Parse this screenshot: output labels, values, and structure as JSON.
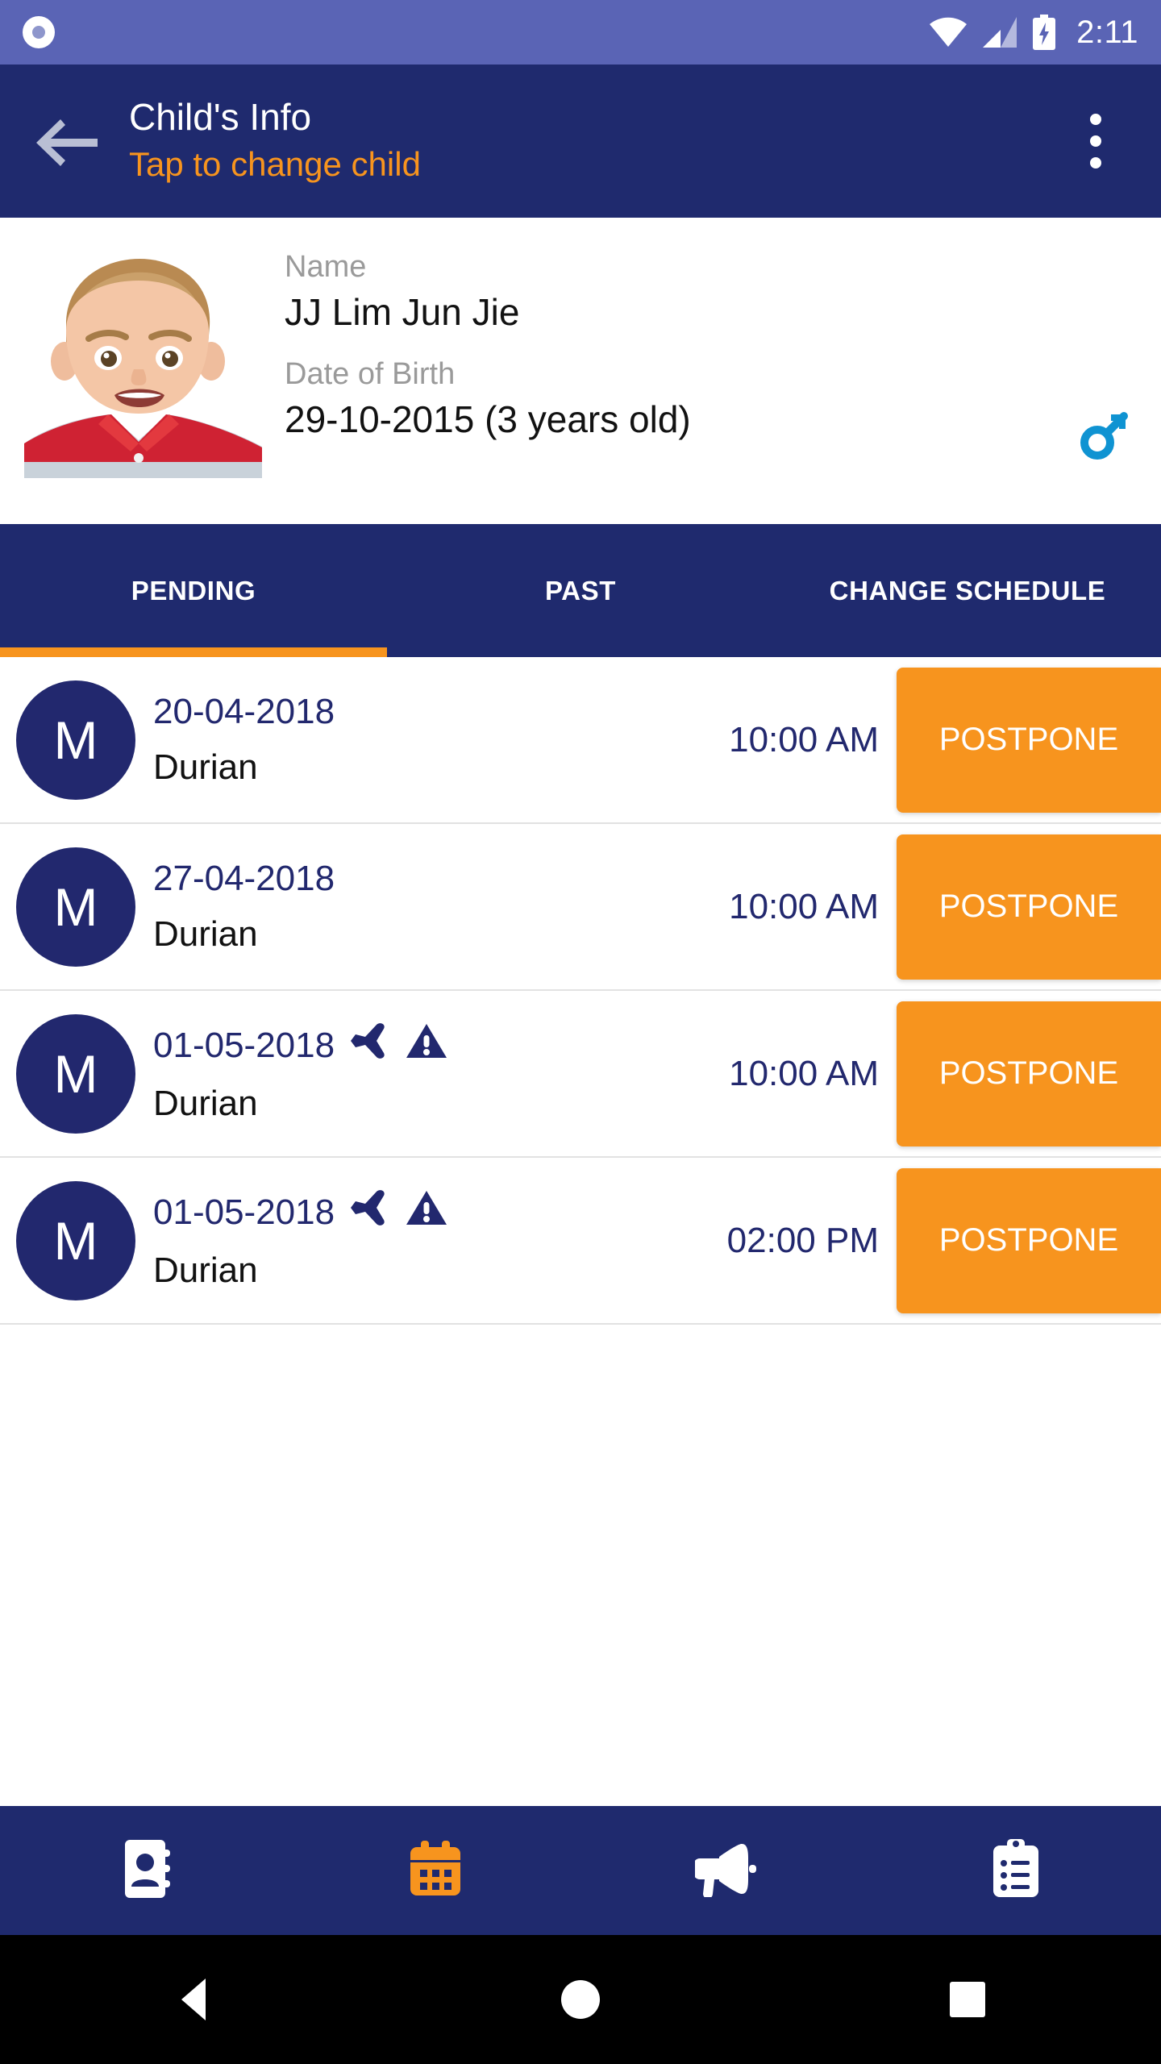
{
  "status_bar": {
    "time": "2:11",
    "icons": [
      "record-dot-icon",
      "wifi-icon",
      "cellular-signal-icon",
      "battery-charging-icon"
    ]
  },
  "app_bar": {
    "back_icon": "back-arrow-icon",
    "title": "Child's Info",
    "subtitle": "Tap to change child",
    "overflow_icon": "overflow-menu-icon"
  },
  "child": {
    "photo_alt": "child-photo",
    "name_label": "Name",
    "name_value": "JJ Lim Jun Jie",
    "dob_label": "Date of Birth",
    "dob_value": "29-10-2015 (3 years old)",
    "gender_icon": "male-gender-icon",
    "gender_color": "#0f93d2"
  },
  "tabs": {
    "items": [
      {
        "label": "PENDING",
        "active": true
      },
      {
        "label": "PAST",
        "active": false
      },
      {
        "label": "CHANGE SCHEDULE",
        "active": false
      }
    ],
    "indicator_color": "#f7941e"
  },
  "appointments": [
    {
      "avatar_letter": "M",
      "date": "20-04-2018",
      "vaccine": "Durian",
      "time": "10:00 AM",
      "action_label": "POSTPONE",
      "flags": []
    },
    {
      "avatar_letter": "M",
      "date": "27-04-2018",
      "vaccine": "Durian",
      "time": "10:00 AM",
      "action_label": "POSTPONE",
      "flags": []
    },
    {
      "avatar_letter": "M",
      "date": "01-05-2018",
      "vaccine": "Durian",
      "time": "10:00 AM",
      "action_label": "POSTPONE",
      "flags": [
        "airplane-icon",
        "warning-icon"
      ]
    },
    {
      "avatar_letter": "M",
      "date": "01-05-2018",
      "vaccine": "Durian",
      "time": "02:00 PM",
      "action_label": "POSTPONE",
      "flags": [
        "airplane-icon",
        "warning-icon"
      ]
    }
  ],
  "bottom_nav": {
    "items": [
      {
        "icon": "contacts-book-icon",
        "active": false
      },
      {
        "icon": "calendar-icon",
        "active": true
      },
      {
        "icon": "megaphone-icon",
        "active": false
      },
      {
        "icon": "clipboard-list-icon",
        "active": false
      }
    ],
    "active_color": "#f7941e",
    "inactive_color": "#ffffff"
  },
  "android_nav": {
    "items": [
      "back-nav-icon",
      "home-nav-icon",
      "recents-nav-icon"
    ]
  },
  "theme": {
    "primary_navy": "#1f2a6e",
    "accent_orange": "#f7941e",
    "status_bar_blue": "#5a64b5"
  }
}
